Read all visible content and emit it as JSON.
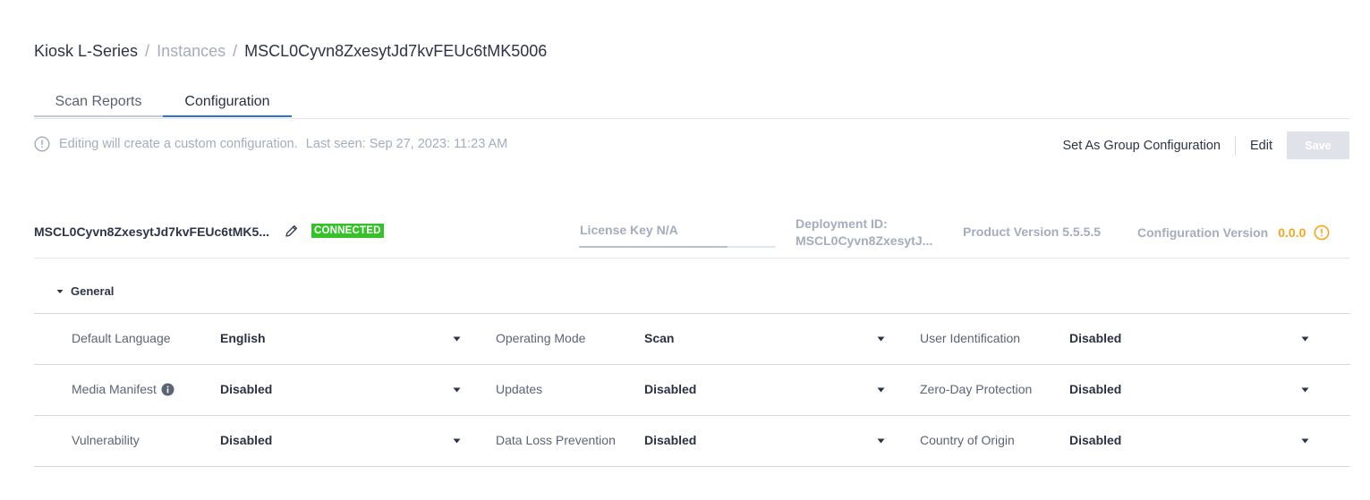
{
  "breadcrumb": {
    "root": "Kiosk L-Series",
    "separator": "/",
    "link": "Instances",
    "current": "MSCL0Cyvn8ZxesytJd7kvFEUc6tMK5006"
  },
  "tabs": [
    {
      "label": "Scan Reports",
      "active": false
    },
    {
      "label": "Configuration",
      "active": true
    }
  ],
  "info_bar": {
    "message": "Editing will create a custom configuration.",
    "last_seen": "Last seen: Sep 27, 2023: 11:23 AM"
  },
  "actions": {
    "set_group_label": "Set As Group Configuration",
    "edit_label": "Edit",
    "save_label": "Save"
  },
  "instance": {
    "name": "MSCL0Cyvn8ZxesytJd7kvFEUc6tMK5...",
    "status": "CONNECTED",
    "license_key": "License Key N/A",
    "deployment_label": "Deployment ID:",
    "deployment_id": "MSCL0Cyvn8ZxesytJ...",
    "product_version": "Product Version 5.5.5.5",
    "configuration_version_label": "Configuration Version",
    "configuration_version": "0.0.0"
  },
  "general": {
    "title": "General",
    "rows": [
      [
        {
          "label": "Default Language",
          "value": "English"
        },
        {
          "label": "Operating Mode",
          "value": "Scan"
        },
        {
          "label": "User Identification",
          "value": "Disabled"
        }
      ],
      [
        {
          "label": "Media Manifest",
          "value": "Disabled"
        },
        {
          "label": "Updates",
          "value": "Disabled"
        },
        {
          "label": "Zero-Day Protection",
          "value": "Disabled"
        }
      ],
      [
        {
          "label": "Vulnerability",
          "value": "Disabled"
        },
        {
          "label": "Data Loss Prevention",
          "value": "Disabled"
        },
        {
          "label": "Country of Origin",
          "value": "Disabled"
        }
      ]
    ]
  },
  "colors": {
    "accent": "#2f6fd0",
    "connected": "#36c02a",
    "warning": "#f0a820",
    "muted": "#a5acbb"
  }
}
